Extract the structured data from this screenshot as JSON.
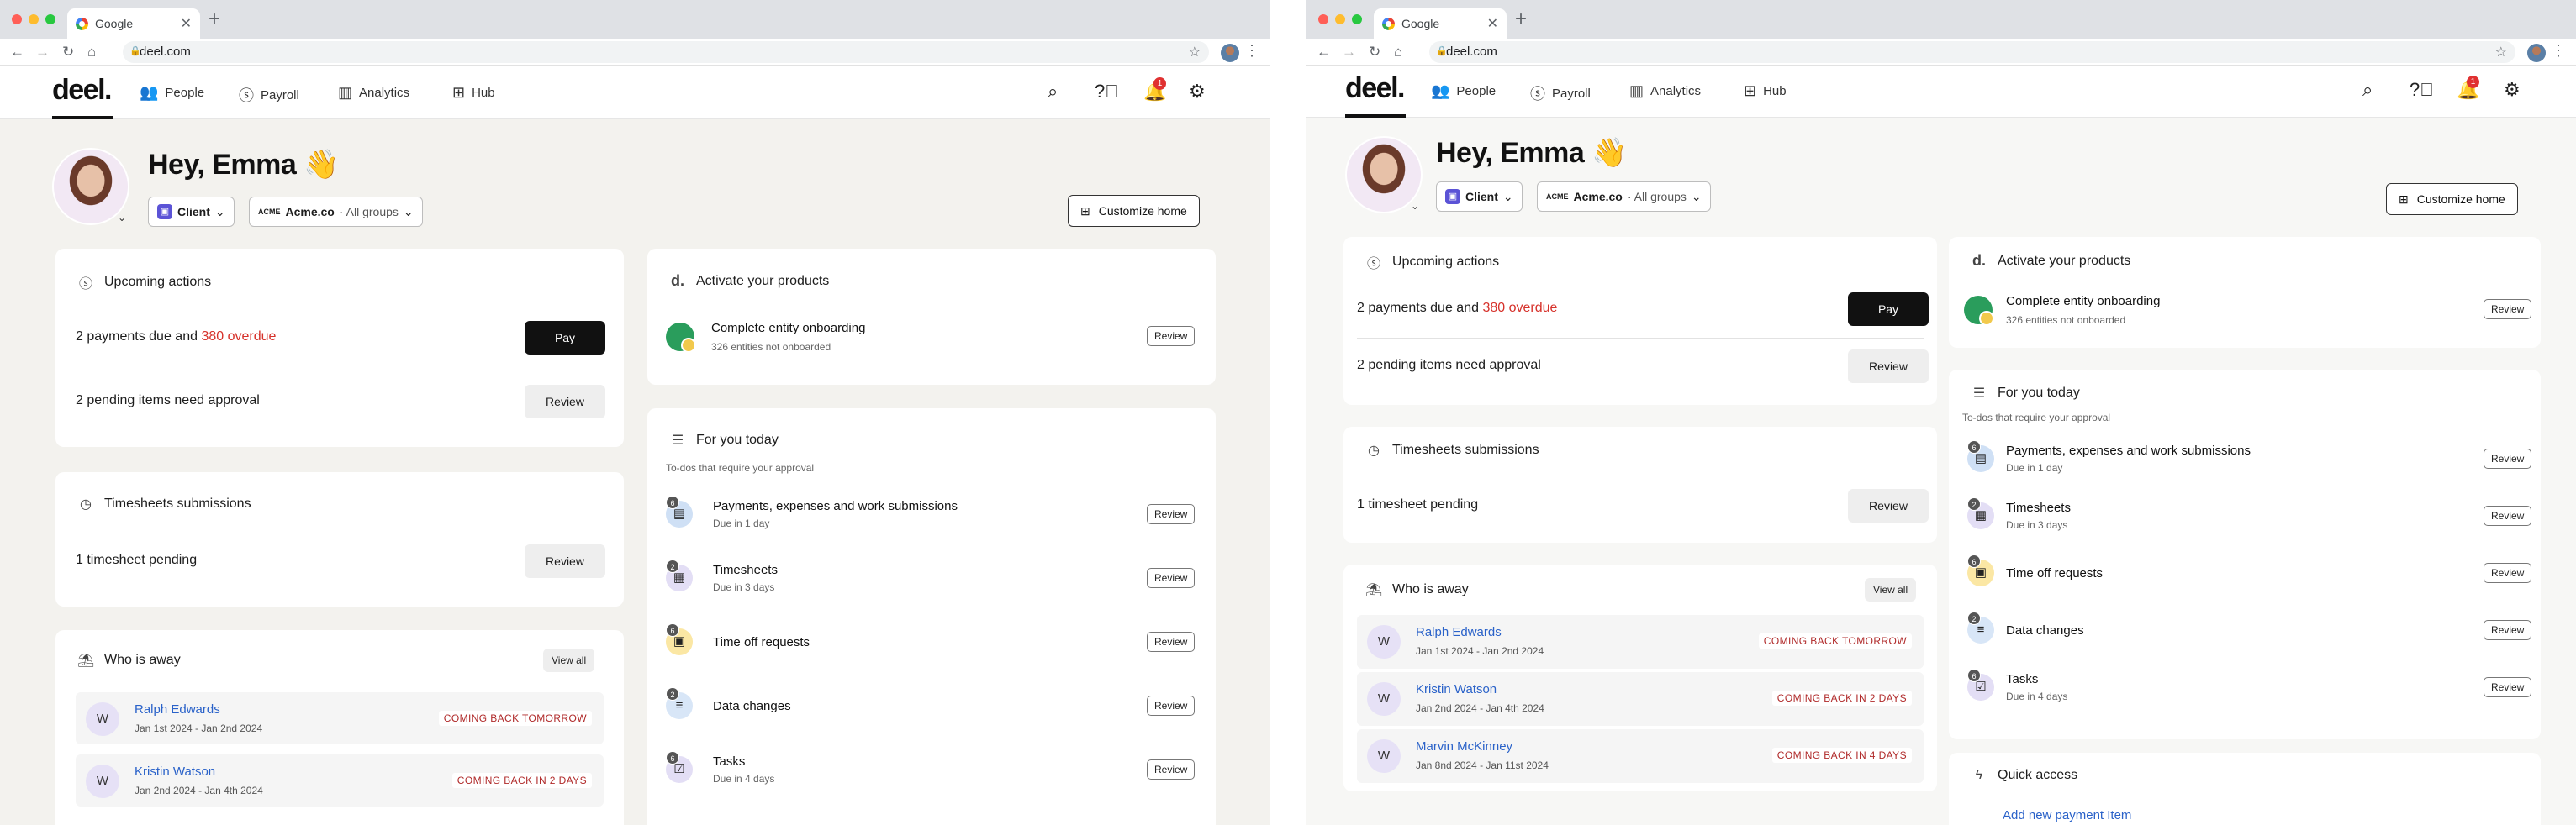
{
  "browser": {
    "tab_title": "Google",
    "url": "deel.com"
  },
  "nav": {
    "logo": "deel.",
    "items": [
      "People",
      "Payroll",
      "Analytics",
      "Hub"
    ],
    "notification_count": "1"
  },
  "greeting": {
    "text": "Hey, Emma 👋",
    "role": "Client",
    "org": "Acme.co",
    "org_sub": "· All groups",
    "customize": "Customize home"
  },
  "upcoming": {
    "title": "Upcoming actions",
    "payments_prefix": "2 payments due and ",
    "overdue": "380 overdue",
    "pay": "Pay",
    "pending": "2 pending items need approval",
    "review": "Review"
  },
  "timesheets": {
    "title": "Timesheets submissions",
    "pending": "1 timesheet pending",
    "review": "Review"
  },
  "away": {
    "title": "Who is away",
    "view_all": "View all",
    "people": [
      {
        "initial": "W",
        "name": "Ralph Edwards",
        "dates": "Jan 1st 2024 - Jan 2nd 2024",
        "tag": "COMING BACK  TOMORROW"
      },
      {
        "initial": "W",
        "name": "Kristin Watson",
        "dates": "Jan 2nd 2024 - Jan 4th 2024",
        "tag": "COMING BACK IN 2 DAYS"
      },
      {
        "initial": "W",
        "name": "Marvin McKinney",
        "dates": "Jan 8nd 2024 - Jan 11st 2024",
        "tag": "COMING BACK IN 4 DAYS"
      }
    ]
  },
  "activate": {
    "title": "Activate your products",
    "item_title": "Complete entity onboarding",
    "item_sub": "326 entities not onboarded",
    "review": "Review"
  },
  "foryou": {
    "title": "For you today",
    "subtitle": "To-dos that require your approval",
    "review": "Review",
    "items": [
      {
        "title": "Payments, expenses and work submissions",
        "sub": "Due in 1 day",
        "badge": "6",
        "icon": "receipt-icon",
        "glyph": "▤",
        "color": "#cfe0f5"
      },
      {
        "title": "Timesheets",
        "sub": "Due in 3 days",
        "badge": "2",
        "icon": "timesheet-icon",
        "glyph": "▦",
        "color": "#e3def5"
      },
      {
        "title": "Time off requests",
        "sub": "",
        "badge": "6",
        "icon": "calendar-icon",
        "glyph": "▣",
        "color": "#fbe7a4"
      },
      {
        "title": "Data changes",
        "sub": "",
        "badge": "2",
        "icon": "edit-list-icon",
        "glyph": "≡",
        "color": "#d8e6f7"
      },
      {
        "title": "Tasks",
        "sub": "Due in 4 days",
        "badge": "6",
        "icon": "task-check-icon",
        "glyph": "☑",
        "color": "#e3def5"
      }
    ]
  },
  "quick_access": {
    "title": "Quick access",
    "link": "Add new payment Item"
  },
  "colors": {
    "overdue": "#d6312a",
    "link": "#2a62c9",
    "accent": "#5b53d6"
  }
}
